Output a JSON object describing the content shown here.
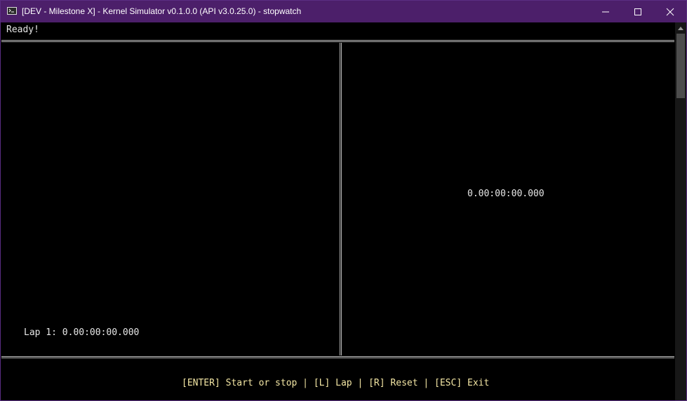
{
  "window": {
    "title": "[DEV - Milestone X] - Kernel Simulator v0.1.0.0 (API v3.0.25.0) - stopwatch",
    "controls": [
      "minimize-icon",
      "maximize-icon",
      "close-icon"
    ]
  },
  "status": {
    "text": "Ready!"
  },
  "laps": [
    {
      "text": "Lap 1: 0.00:00:00.000"
    }
  ],
  "stopwatch": {
    "elapsed": "0.00:00:00.000"
  },
  "hotkeys": {
    "text": "[ENTER] Start or stop | [L] Lap | [R] Reset | [ESC] Exit"
  },
  "colors": {
    "titlebar": "#4c1f6a",
    "text": "#e6e6e6",
    "hotkeys": "#f3e6a4",
    "border": "#bdbdbd"
  }
}
